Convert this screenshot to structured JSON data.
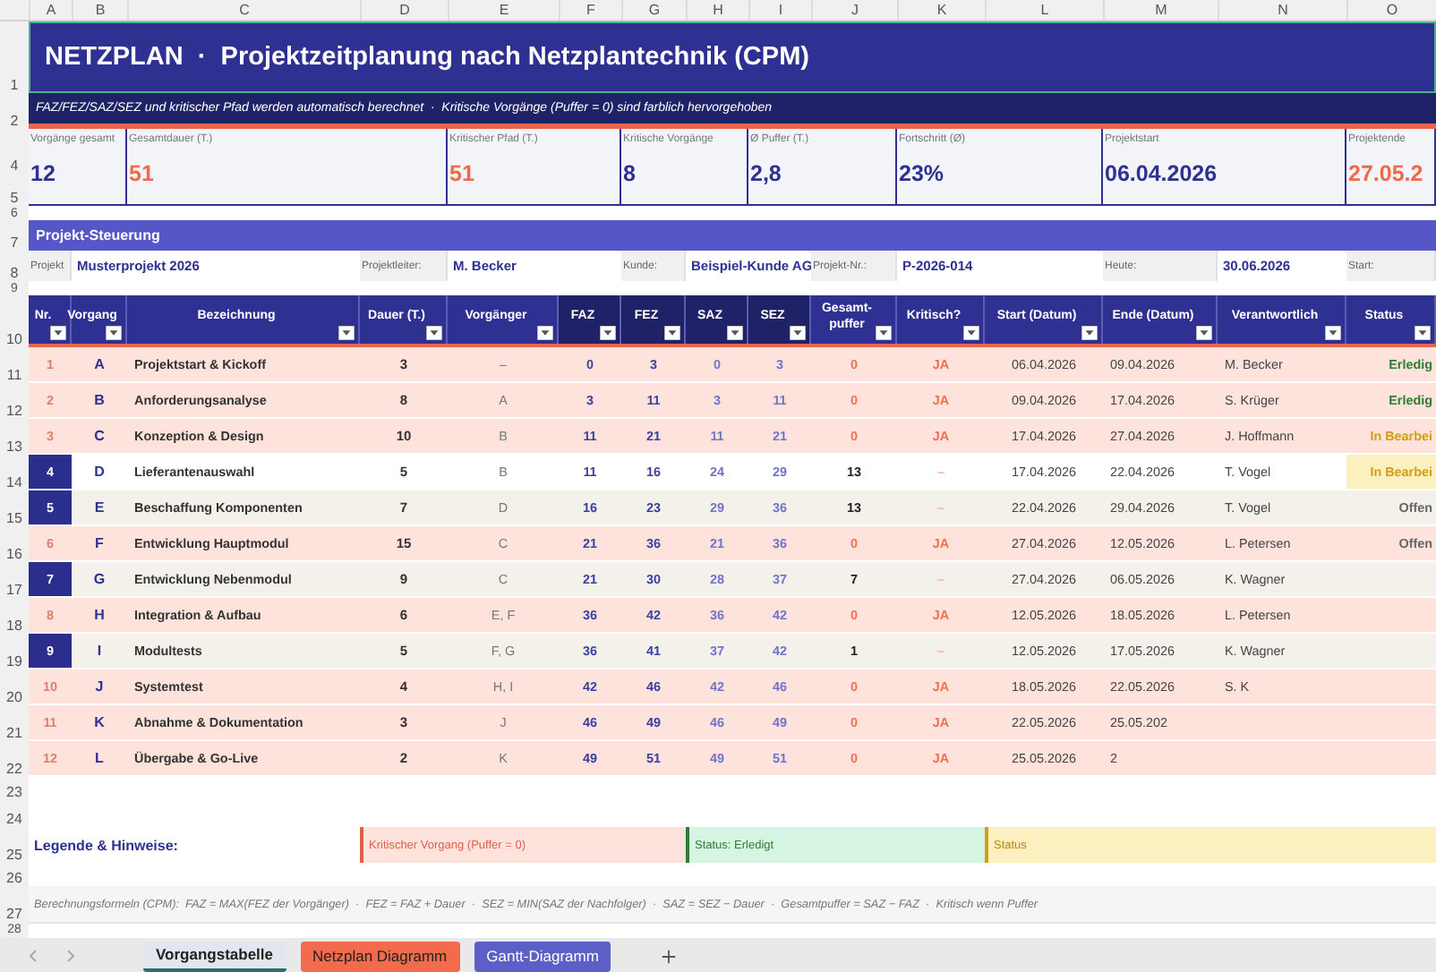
{
  "column_letters": [
    "A",
    "B",
    "C",
    "D",
    "E",
    "F",
    "G",
    "H",
    "I",
    "J",
    "K",
    "L",
    "M",
    "N",
    "O"
  ],
  "row_numbers": [
    "1",
    "2",
    "4",
    "5",
    "6",
    "7",
    "8",
    "9",
    "10",
    "11",
    "12",
    "13",
    "14",
    "15",
    "16",
    "17",
    "18",
    "19",
    "20",
    "21",
    "22",
    "23",
    "24",
    "25",
    "26",
    "27",
    "28"
  ],
  "title": "NETZPLAN  ·  Projektzeitplanung nach Netzplantechnik (CPM)",
  "subtitle": "FAZ/FEZ/SAZ/SEZ und kritischer Pfad werden automatisch berechnet  ·  Kritische Vorgänge (Puffer = 0) sind farblich hervorgehoben",
  "kpis": [
    {
      "label": "Vorgänge gesamt",
      "value": "12",
      "alert": false
    },
    {
      "label": "Gesamtdauer (T.)",
      "value": "51",
      "alert": true
    },
    {
      "label": "Kritischer Pfad (T.)",
      "value": "51",
      "alert": true
    },
    {
      "label": "Kritische Vorgänge",
      "value": "8",
      "alert": false
    },
    {
      "label": "Ø Puffer (T.)",
      "value": "2,8",
      "alert": false
    },
    {
      "label": "Fortschritt (Ø)",
      "value": "23%",
      "alert": false
    },
    {
      "label": "Projektstart",
      "value": "06.04.2026",
      "alert": false
    },
    {
      "label": "Projektende",
      "value": "27.05.2",
      "alert": true
    }
  ],
  "section_title": "Projekt-Steuerung",
  "info": [
    {
      "label": "Projekt",
      "value": "Musterprojekt 2026"
    },
    {
      "label": "Projektleiter:",
      "value": "M. Becker"
    },
    {
      "label": "Kunde:",
      "value": "Beispiel-Kunde AG"
    },
    {
      "label": "Projekt-Nr.:",
      "value": "P-2026-014"
    },
    {
      "label": "Heute:",
      "value": "30.06.2026"
    },
    {
      "label": "Start:"
    }
  ],
  "table": {
    "columns": [
      "Nr.",
      "Vorgang",
      "Bezeichnung",
      "Dauer (T.)",
      "Vorgänger",
      "FAZ",
      "FEZ",
      "SAZ",
      "SEZ",
      "Gesamt-puffer",
      "Kritisch?",
      "Start (Datum)",
      "Ende (Datum)",
      "Verantwortlich",
      "Status"
    ],
    "rows": [
      {
        "kind": "critical",
        "nr": "1",
        "code": "A",
        "name": "Projektstart & Kickoff",
        "duration": "3",
        "predecessors": "–",
        "faz": "0",
        "fez": "3",
        "saz": "0",
        "sez": "3",
        "slack": "0",
        "critical": "JA",
        "start": "06.04.2026",
        "end": "09.04.2026",
        "owner": "M. Becker",
        "status": {
          "text": "Erledig",
          "kind": "done"
        }
      },
      {
        "kind": "critical",
        "nr": "2",
        "code": "B",
        "name": "Anforderungsanalyse",
        "duration": "8",
        "predecessors": "A",
        "faz": "3",
        "fez": "11",
        "saz": "3",
        "sez": "11",
        "slack": "0",
        "critical": "JA",
        "start": "09.04.2026",
        "end": "17.04.2026",
        "owner": "S. Krüger",
        "status": {
          "text": "Erledig",
          "kind": "done"
        }
      },
      {
        "kind": "critical",
        "nr": "3",
        "code": "C",
        "name": "Konzeption & Design",
        "duration": "10",
        "predecessors": "B",
        "faz": "11",
        "fez": "21",
        "saz": "11",
        "sez": "21",
        "slack": "0",
        "critical": "JA",
        "start": "17.04.2026",
        "end": "27.04.2026",
        "owner": "J. Hoffmann",
        "status": {
          "text": "In Bearbei",
          "kind": "progress"
        }
      },
      {
        "kind": "plain",
        "nr": "4",
        "code": "D",
        "name": "Lieferantenauswahl",
        "duration": "5",
        "predecessors": "B",
        "faz": "11",
        "fez": "16",
        "saz": "24",
        "sez": "29",
        "slack": "13",
        "critical": "–",
        "start": "17.04.2026",
        "end": "22.04.2026",
        "owner": "T. Vogel",
        "status": {
          "text": "In Bearbei",
          "kind": "progress"
        }
      },
      {
        "kind": "tinted",
        "nr": "5",
        "code": "E",
        "name": "Beschaffung Komponenten",
        "duration": "7",
        "predecessors": "D",
        "faz": "16",
        "fez": "23",
        "saz": "29",
        "sez": "36",
        "slack": "13",
        "critical": "–",
        "start": "22.04.2026",
        "end": "29.04.2026",
        "owner": "T. Vogel",
        "status": {
          "text": "Offen",
          "kind": "open"
        }
      },
      {
        "kind": "critical",
        "nr": "6",
        "code": "F",
        "name": "Entwicklung Hauptmodul",
        "duration": "15",
        "predecessors": "C",
        "faz": "21",
        "fez": "36",
        "saz": "21",
        "sez": "36",
        "slack": "0",
        "critical": "JA",
        "start": "27.04.2026",
        "end": "12.05.2026",
        "owner": "L. Petersen",
        "status": {
          "text": "Offen",
          "kind": "open"
        }
      },
      {
        "kind": "tinted",
        "nr": "7",
        "code": "G",
        "name": "Entwicklung Nebenmodul",
        "duration": "9",
        "predecessors": "C",
        "faz": "21",
        "fez": "30",
        "saz": "28",
        "sez": "37",
        "slack": "7",
        "critical": "–",
        "start": "27.04.2026",
        "end": "06.05.2026",
        "owner": "K. Wagner"
      },
      {
        "kind": "critical",
        "nr": "8",
        "code": "H",
        "name": "Integration & Aufbau",
        "duration": "6",
        "predecessors": "E, F",
        "faz": "36",
        "fez": "42",
        "saz": "36",
        "sez": "42",
        "slack": "0",
        "critical": "JA",
        "start": "12.05.2026",
        "end": "18.05.2026",
        "owner": "L. Petersen"
      },
      {
        "kind": "tinted",
        "nr": "9",
        "code": "I",
        "name": "Modultests",
        "duration": "5",
        "predecessors": "F, G",
        "faz": "36",
        "fez": "41",
        "saz": "37",
        "sez": "42",
        "slack": "1",
        "critical": "–",
        "start": "12.05.2026",
        "end": "17.05.2026",
        "owner": "K. Wagner"
      },
      {
        "kind": "critical",
        "nr": "10",
        "code": "J",
        "name": "Systemtest",
        "duration": "4",
        "predecessors": "H, I",
        "faz": "42",
        "fez": "46",
        "saz": "42",
        "sez": "46",
        "slack": "0",
        "critical": "JA",
        "start": "18.05.2026",
        "end": "22.05.2026",
        "owner": "S. K"
      },
      {
        "kind": "critical",
        "nr": "11",
        "code": "K",
        "name": "Abnahme & Dokumentation",
        "duration": "3",
        "predecessors": "J",
        "faz": "46",
        "fez": "49",
        "saz": "46",
        "sez": "49",
        "slack": "0",
        "critical": "JA",
        "start": "22.05.2026",
        "end": "25.05.202"
      },
      {
        "kind": "critical",
        "nr": "12",
        "code": "L",
        "name": "Übergabe & Go-Live",
        "duration": "2",
        "predecessors": "K",
        "faz": "49",
        "fez": "51",
        "saz": "49",
        "sez": "51",
        "slack": "0",
        "critical": "JA",
        "start": "25.05.2026",
        "end": "2"
      }
    ]
  },
  "legend": {
    "title": "Legende & Hinweise:",
    "items": [
      {
        "kind": "critical",
        "text": "Kritischer Vorgang (Puffer = 0)"
      },
      {
        "kind": "done",
        "text": "Status: Erledigt"
      },
      {
        "kind": "progress",
        "text": "Status"
      }
    ]
  },
  "formula": "Berechnungsformeln (CPM):  FAZ = MAX(FEZ der Vorgänger)  ·  FEZ = FAZ + Dauer  ·  SEZ = MIN(SAZ der Nachfolger)  ·  SAZ = SEZ − Dauer  ·  Gesamtpuffer = SAZ − FAZ  ·  Kritisch wenn Puffer",
  "sheet_tabs": [
    {
      "label": "Vorgangstabelle",
      "selected": true,
      "color": "#e4e6ef"
    },
    {
      "label": "Netzplan Diagramm",
      "selected": false,
      "color": "#f26b4c"
    },
    {
      "label": "Gantt-Diagramm",
      "selected": false,
      "color": "#5b5fc7"
    }
  ]
}
